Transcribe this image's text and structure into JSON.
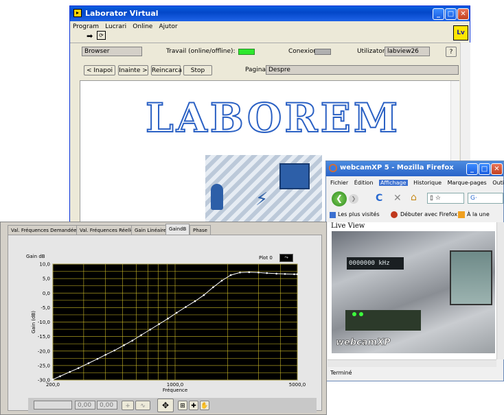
{
  "lv": {
    "title": "Laborator Virtual",
    "menu": [
      "Program",
      "Lucrari",
      "Online",
      "Ajutor"
    ],
    "browser_field": "Browser",
    "status_label": "Travail (online/offline):",
    "conexion_label": "Conexion:",
    "user_label": "Utilizator:",
    "user_value": "labview26",
    "help_btn": "?",
    "nav": {
      "back": "< Inapoi",
      "forward": "Inainte >",
      "reload": "Reincarca",
      "stop": "Stop"
    },
    "page_label": "Pagina:",
    "page_value": "Despre",
    "logo_text": "LABOREM"
  },
  "firefox": {
    "title": "webcamXP 5 - Mozilla Firefox",
    "menu": [
      "Fichier",
      "Édition",
      "Affichage",
      "Historique",
      "Marque-pages",
      "Outils"
    ],
    "bookmarks": [
      "Les plus visités",
      "Débuter avec Firefox",
      "À la une"
    ],
    "live_view": "Live View",
    "display_value": "0000000",
    "display_unit": "kHz",
    "watermark": "webcamXP",
    "status": "Terminé"
  },
  "graph": {
    "tabs": [
      "Val. Fréquences Demandées",
      "Val. Fréquences Réelles",
      "Gain Linéaire",
      "GaindB",
      "Phase"
    ],
    "active_tab": 3,
    "plot_legend": "Plot 0",
    "inputs": [
      "0,00",
      "0,00"
    ],
    "colors": {
      "plot_bg": "#000000",
      "grid": "#d4c12a",
      "trace": "#ffffff"
    }
  },
  "chart_data": {
    "type": "line",
    "title": "Gain dB",
    "xlabel": "Fréquence",
    "ylabel": "Gain (dB)",
    "xscale": "log",
    "xlim": [
      200,
      5000
    ],
    "ylim": [
      -30,
      10
    ],
    "xticks": [
      "200,0",
      "1000,0",
      "5000,0"
    ],
    "yticks": [
      "10,0",
      "5,0",
      "0,0",
      "-5,0",
      "-10,0",
      "-15,0",
      "-20,0",
      "-25,0",
      "-30,0"
    ],
    "series": [
      {
        "name": "Plot 0",
        "x": [
          200,
          220,
          250,
          280,
          320,
          360,
          400,
          450,
          510,
          570,
          640,
          720,
          810,
          910,
          1020,
          1150,
          1300,
          1460,
          1650,
          1850,
          2080,
          2350,
          2650,
          3000,
          3350,
          3800,
          4250,
          4800,
          5000
        ],
        "y": [
          -29.8,
          -28.7,
          -27.2,
          -25.9,
          -24.2,
          -22.7,
          -21.3,
          -19.8,
          -18.0,
          -16.4,
          -14.5,
          -12.6,
          -10.7,
          -8.8,
          -6.8,
          -4.8,
          -2.8,
          -0.7,
          2.0,
          4.3,
          6.2,
          7.1,
          7.2,
          7.1,
          6.9,
          6.7,
          6.6,
          6.5,
          6.5
        ]
      }
    ]
  }
}
